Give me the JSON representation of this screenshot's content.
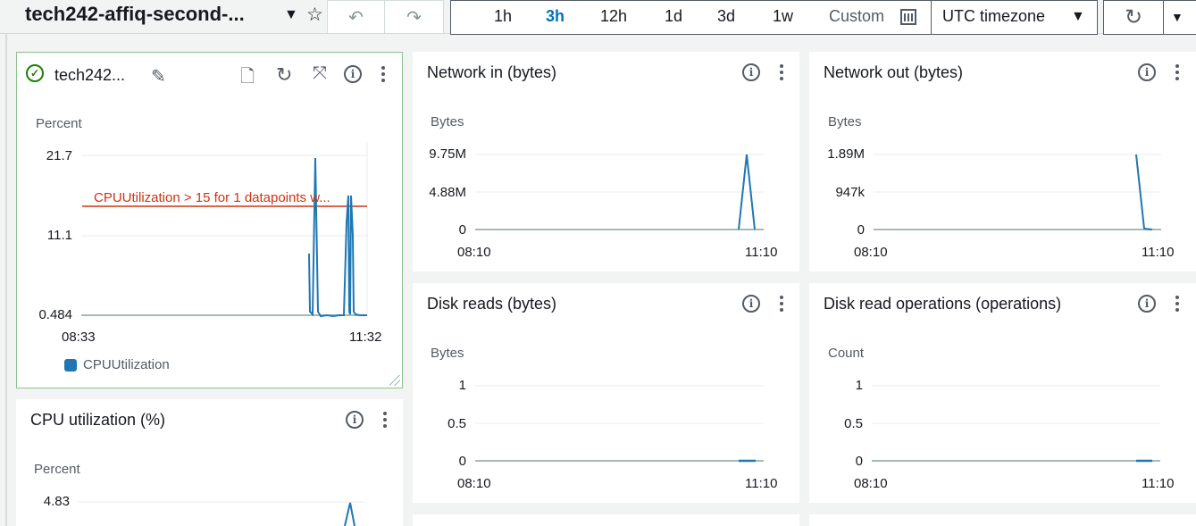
{
  "dashboard": {
    "title": "tech242-affiq-second-...",
    "time_ranges": [
      "1h",
      "3h",
      "12h",
      "1d",
      "3d",
      "1w"
    ],
    "active_range": "3h",
    "custom_label": "Custom",
    "timezone": "UTC timezone"
  },
  "widgets": {
    "alarm": {
      "title": "tech242...",
      "status": "OK",
      "unit": "Percent",
      "yticks": [
        "21.7",
        "11.1",
        "0.484"
      ],
      "xticks": [
        "08:33",
        "11:32"
      ],
      "threshold_label": "CPUUtilization > 15 for 1 datapoints w...",
      "legend": "CPUUtilization"
    },
    "cpu": {
      "title": "CPU utilization (%)",
      "unit": "Percent",
      "yticks": [
        "4.83"
      ]
    },
    "net_in": {
      "title": "Network in (bytes)",
      "unit": "Bytes",
      "yticks": [
        "9.75M",
        "4.88M",
        "0"
      ],
      "xticks": [
        "08:10",
        "11:10"
      ]
    },
    "net_out": {
      "title": "Network out (bytes)",
      "unit": "Bytes",
      "yticks": [
        "1.89M",
        "947k",
        "0"
      ],
      "xticks": [
        "08:10",
        "11:10"
      ]
    },
    "disk_reads": {
      "title": "Disk reads (bytes)",
      "unit": "Bytes",
      "yticks": [
        "1",
        "0.5",
        "0"
      ],
      "xticks": [
        "08:10",
        "11:10"
      ]
    },
    "disk_ops": {
      "title": "Disk read operations (operations)",
      "unit": "Count",
      "yticks": [
        "1",
        "0.5",
        "0"
      ],
      "xticks": [
        "08:10",
        "11:10"
      ]
    }
  },
  "colors": {
    "series": "#1f77b4",
    "threshold": "#d13212",
    "active": "#0073bb",
    "status_ok": "#1d8102"
  },
  "icons": [
    "dropdown-caret-icon",
    "star-icon",
    "undo-icon",
    "redo-icon",
    "calendar-icon",
    "refresh-icon",
    "check-circle-icon",
    "edit-icon",
    "file-icon",
    "expand-icon",
    "info-icon",
    "kebab-menu-icon"
  ]
}
